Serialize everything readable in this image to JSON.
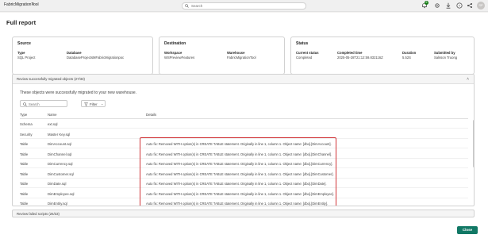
{
  "app": {
    "title": "FabricMigrationTool"
  },
  "search": {
    "placeholder": "Search"
  },
  "notifications": {
    "count": "6"
  },
  "user": {
    "initials": "SP"
  },
  "page": {
    "title": "Full report"
  },
  "source": {
    "title": "Source",
    "type_label": "Type",
    "type_value": "SQL Project",
    "database_label": "Database",
    "database_value": "DatabaseProjectsMFabricMigrationpoc"
  },
  "destination": {
    "title": "Destination",
    "workspace_label": "Workspace",
    "workspace_value": "WSPreviewFeatures",
    "warehouse_label": "Warehouse",
    "warehouse_value": "FabricMigrationTool"
  },
  "status": {
    "title": "Status",
    "current_label": "Current status",
    "current_value": "Completed",
    "completed_label": "Completed time",
    "completed_value": "2025-05-28T21:12:59.832116Z",
    "duration_label": "Duration",
    "duration_value": "5.52S",
    "submitted_label": "Submitted by",
    "submitted_value": "Salsson Truong"
  },
  "migrated": {
    "header": "Review successfully migrated objects (27/33)",
    "description": "These objects were successfully migrated to your new warehouse.",
    "search_placeholder": "Search",
    "filter_label": "Filter",
    "columns": {
      "type": "Type",
      "name": "Name",
      "details": "Details"
    },
    "rows": [
      {
        "type": "Schema",
        "name": "ext.sql",
        "details": ""
      },
      {
        "type": "Security",
        "name": "Master Key.sql",
        "details": ""
      },
      {
        "type": "Table",
        "name": "DimAccount.sql",
        "details": "Auto fix: Removed WITH option(s) in CREATE TABLE statement. Originally in line 1, column 1. Object name: [dbo].[DimAccount]."
      },
      {
        "type": "Table",
        "name": "DimChannel.sql",
        "details": "Auto fix: Removed WITH option(s) in CREATE TABLE statement. Originally in line 1, column 1. Object name: [dbo].[DimChannel]."
      },
      {
        "type": "Table",
        "name": "DimCurrency.sql",
        "details": "Auto fix: Removed WITH option(s) in CREATE TABLE statement. Originally in line 1, column 1. Object name: [dbo].[DimCurrency]."
      },
      {
        "type": "Table",
        "name": "DimCustomer.sql",
        "details": "Auto fix: Removed WITH option(s) in CREATE TABLE statement. Originally in line 1, column 1. Object name: [dbo].[DimCustomer]."
      },
      {
        "type": "Table",
        "name": "DimDate.sql",
        "details": "Auto fix: Removed WITH option(s) in CREATE TABLE statement. Originally in line 1, column 1. Object name: [dbo].[DimDate]."
      },
      {
        "type": "Table",
        "name": "DimEmployee.sql",
        "details": "Auto fix: Removed WITH option(s) in CREATE TABLE statement. Originally in line 1, column 1. Object name: [dbo].[DimEmployee]."
      },
      {
        "type": "Table",
        "name": "DimEntity.sql",
        "details": "Auto fix: Removed WITH option(s) in CREATE TABLE statement. Originally in line 1, column 1. Object name: [dbo].[DimEntity]."
      }
    ]
  },
  "failed": {
    "header": "Review failed scripts (26/33)"
  },
  "footer": {
    "close_label": "Close"
  },
  "colors": {
    "accent": "#117865",
    "highlight": "#d13438",
    "badge": "#107c10"
  }
}
